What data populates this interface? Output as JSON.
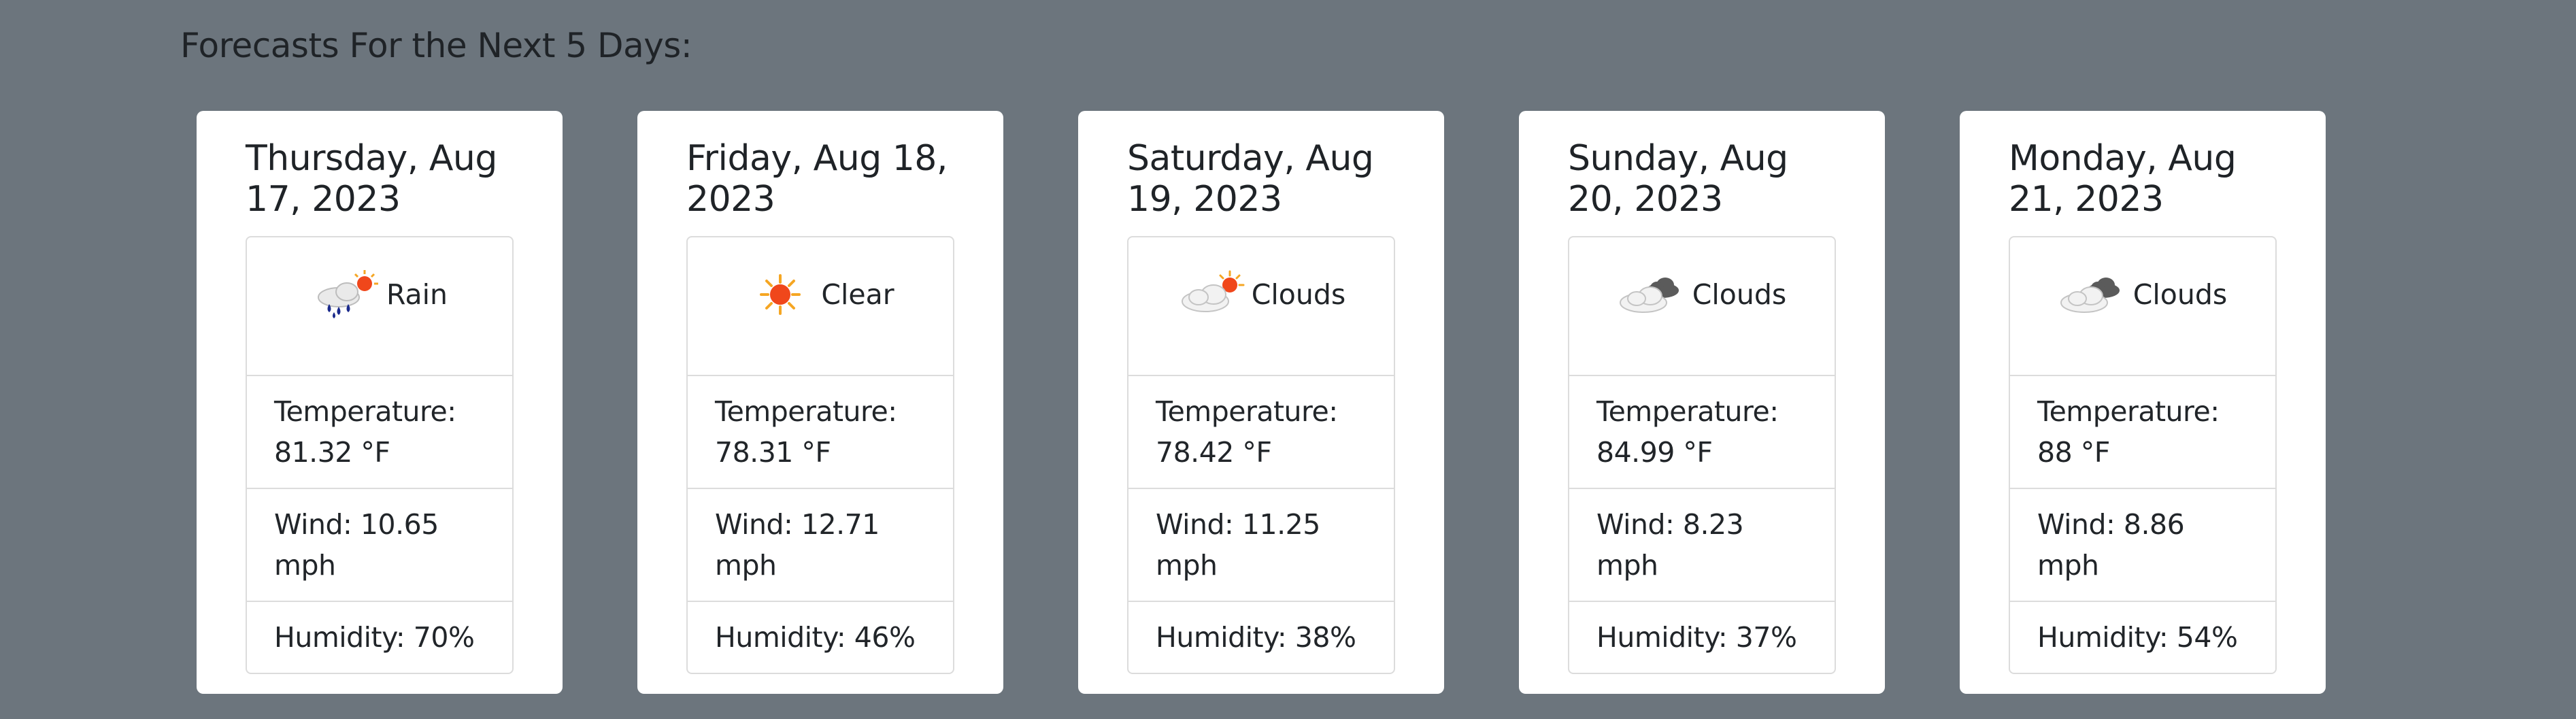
{
  "page": {
    "heading": "Forecasts For the Next 5 Days:"
  },
  "labels": {
    "temperature": "Temperature:",
    "wind": "Wind:",
    "humidity": "Humidity:"
  },
  "forecast": [
    {
      "date": "Thursday, Aug 17, 2023",
      "condition": "Rain",
      "icon": "rain-sun-icon",
      "temperature": "81.32 °F",
      "wind": "10.65 mph",
      "humidity": "70%"
    },
    {
      "date": "Friday, Aug 18, 2023",
      "condition": "Clear",
      "icon": "sun-icon",
      "temperature": "78.31 °F",
      "wind": "12.71 mph",
      "humidity": "46%"
    },
    {
      "date": "Saturday, Aug 19, 2023",
      "condition": "Clouds",
      "icon": "cloud-sun-icon",
      "temperature": "78.42 °F",
      "wind": "11.25 mph",
      "humidity": "38%"
    },
    {
      "date": "Sunday, Aug 20, 2023",
      "condition": "Clouds",
      "icon": "dark-clouds-icon",
      "temperature": "84.99 °F",
      "wind": "8.23 mph",
      "humidity": "37%"
    },
    {
      "date": "Monday, Aug 21, 2023",
      "condition": "Clouds",
      "icon": "dark-clouds-icon",
      "temperature": "88 °F",
      "wind": "8.86 mph",
      "humidity": "54%"
    }
  ],
  "colors": {
    "page_background": "#6c757d",
    "card_background": "#ffffff",
    "border": "#dcdcdc",
    "sun": "#f0471b",
    "rain": "#1a2a8c",
    "cloud_dark": "#5b5b5b"
  }
}
